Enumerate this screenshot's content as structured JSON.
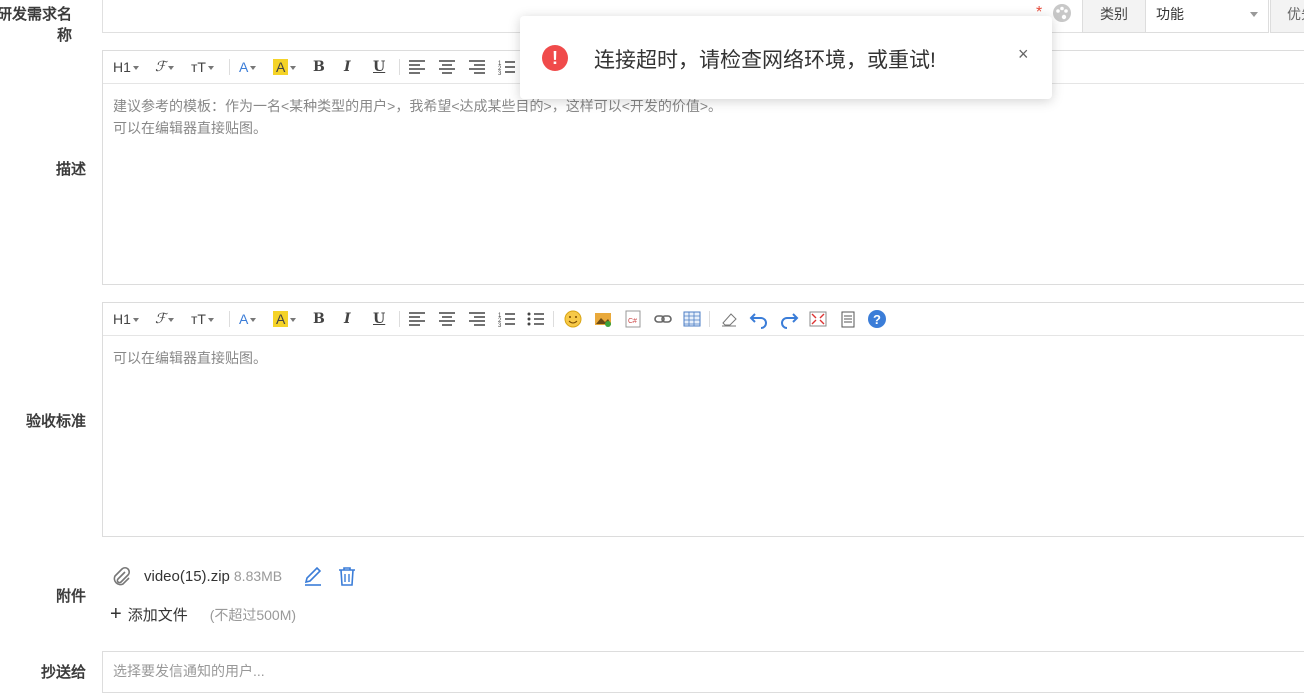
{
  "form": {
    "title_label": "研发需求名称",
    "required_star": "*",
    "type_label": "类别",
    "type_value": "功能",
    "priority_label": "优先级",
    "desc_label": "描述",
    "acceptance_label": "验收标准",
    "attachment_label": "附件",
    "cc_label": "抄送给"
  },
  "desc_editor": {
    "placeholder_line1": "建议参考的模板：作为一名<某种类型的用户>，我希望<达成某些目的>，这样可以<开发的价值>。",
    "placeholder_line2": "可以在编辑器直接贴图。"
  },
  "accept_editor": {
    "placeholder": "可以在编辑器直接贴图。"
  },
  "toolbar": {
    "heading": "H1",
    "font": "ℱ",
    "size": "ᴛT",
    "font_color": "A",
    "bg_color": "A",
    "bold": "B",
    "italic": "I",
    "underline": "U"
  },
  "attachment": {
    "file_name": "video(15).zip",
    "file_size": "8.83MB",
    "add_label": "添加文件",
    "limit": "(不超过500M)"
  },
  "cc": {
    "placeholder": "选择要发信通知的用户..."
  },
  "toast": {
    "message": "连接超时，请检查网络环境，或重试!",
    "close": "×"
  },
  "colors": {
    "error": "#f04b4b",
    "link_icon": "#3b7dd8"
  }
}
